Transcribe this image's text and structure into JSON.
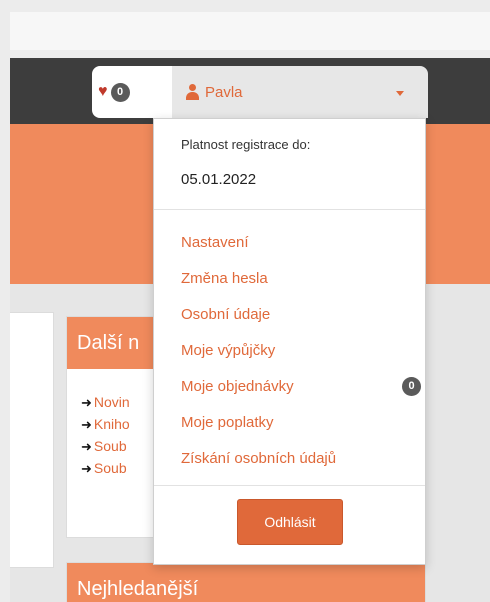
{
  "header": {
    "favorites_count": "0",
    "user_name": "Pavla"
  },
  "account_menu": {
    "registration_label": "Platnost registrace do:",
    "registration_date": "05.01.2022",
    "items": [
      {
        "label": "Nastavení"
      },
      {
        "label": "Změna hesla"
      },
      {
        "label": "Osobní údaje"
      },
      {
        "label": "Moje výpůjčky"
      },
      {
        "label": "Moje objednávky",
        "badge": "0"
      },
      {
        "label": "Moje poplatky"
      },
      {
        "label": "Získání osobních údajů"
      }
    ],
    "logout_label": "Odhlásit"
  },
  "panels": {
    "more": {
      "title": "Další n",
      "links": [
        "Novin",
        "Kniho",
        "Soub",
        "Soub"
      ]
    },
    "popular": {
      "title": "Nejhledanější"
    }
  },
  "colors": {
    "accent": "#e0693a",
    "hero": "#f08a5c",
    "navbar": "#3d3d3d",
    "badge": "#5a5a5a"
  }
}
